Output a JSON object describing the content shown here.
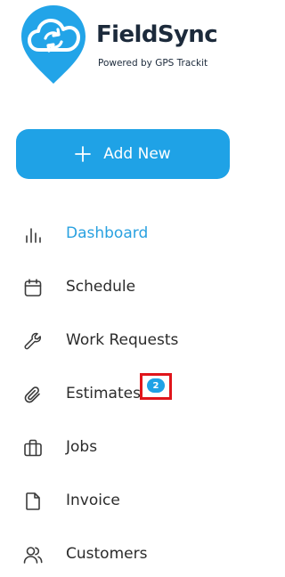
{
  "brand": {
    "name": "FieldSync",
    "tagline": "Powered by GPS Trackit",
    "logo_icon": "cloud-sync-pin-icon",
    "accent_color": "#1fa2e6",
    "text_color": "#1c2a3b"
  },
  "add_button": {
    "label": "Add New",
    "icon": "plus-icon"
  },
  "nav": {
    "items": [
      {
        "label": "Dashboard",
        "icon": "bar-chart-icon",
        "active": true
      },
      {
        "label": "Schedule",
        "icon": "calendar-icon",
        "active": false
      },
      {
        "label": "Work Requests",
        "icon": "wrench-icon",
        "active": false
      },
      {
        "label": "Estimates",
        "icon": "paperclip-icon",
        "active": false,
        "badge": "2"
      },
      {
        "label": "Jobs",
        "icon": "briefcase-icon",
        "active": false
      },
      {
        "label": "Invoice",
        "icon": "document-icon",
        "active": false
      },
      {
        "label": "Customers",
        "icon": "users-icon",
        "active": false
      }
    ]
  }
}
